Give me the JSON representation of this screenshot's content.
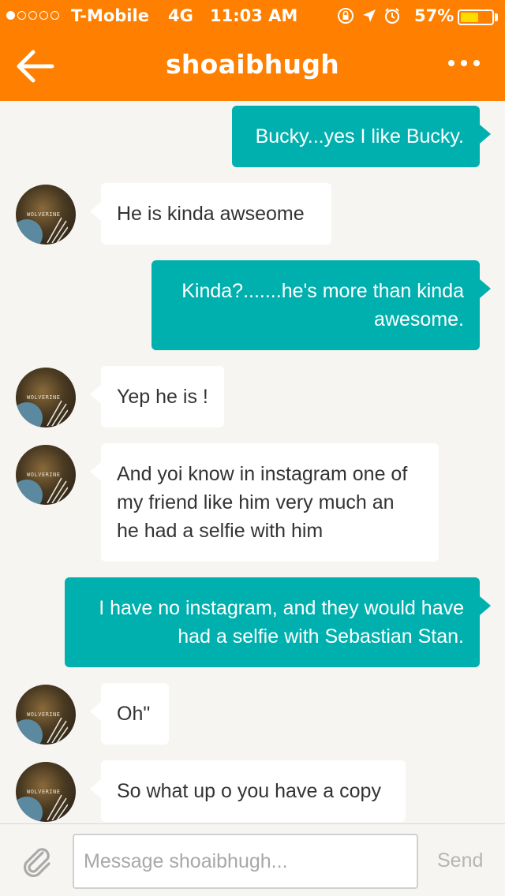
{
  "status_bar": {
    "carrier": "T-Mobile",
    "network": "4G",
    "time": "11:03 AM",
    "battery_percent": "57%",
    "battery_level": 0.57,
    "signal_bars_filled": 1,
    "signal_bars_total": 5,
    "icons": [
      "orientation-lock-icon",
      "location-arrow-icon",
      "alarm-icon"
    ]
  },
  "nav": {
    "title": "shoaibhugh",
    "back_icon": "back-arrow-icon",
    "more_icon": "more-dots-icon"
  },
  "avatar": {
    "logo_text": "WOLVERINE"
  },
  "messages": [
    {
      "direction": "out",
      "lines": [
        "Bucky...yes I like Bucky."
      ]
    },
    {
      "direction": "in",
      "lines": [
        "He is kinda awseome"
      ]
    },
    {
      "direction": "out",
      "lines": [
        "Kinda?.......he's more than kinda",
        "awesome."
      ]
    },
    {
      "direction": "in",
      "lines": [
        "Yep he is !"
      ]
    },
    {
      "direction": "in",
      "lines": [
        "And yoi know in instagram one of",
        "my friend like him very much an",
        "he had a selfie with him"
      ]
    },
    {
      "direction": "out",
      "lines": [
        "I have no instagram, and they would have",
        "had a selfie with Sebastian Stan."
      ]
    },
    {
      "direction": "in",
      "lines": [
        "Oh\""
      ]
    },
    {
      "direction": "in",
      "lines": [
        "So what up o you have a copy"
      ]
    }
  ],
  "input_bar": {
    "attach_icon": "paperclip-icon",
    "placeholder": "Message shoaibhugh...",
    "value": "",
    "send_label": "Send"
  },
  "colors": {
    "header": "#ff7f00",
    "outgoing_bubble": "#00b0ae",
    "incoming_bubble": "#ffffff",
    "background": "#f6f5f1"
  }
}
